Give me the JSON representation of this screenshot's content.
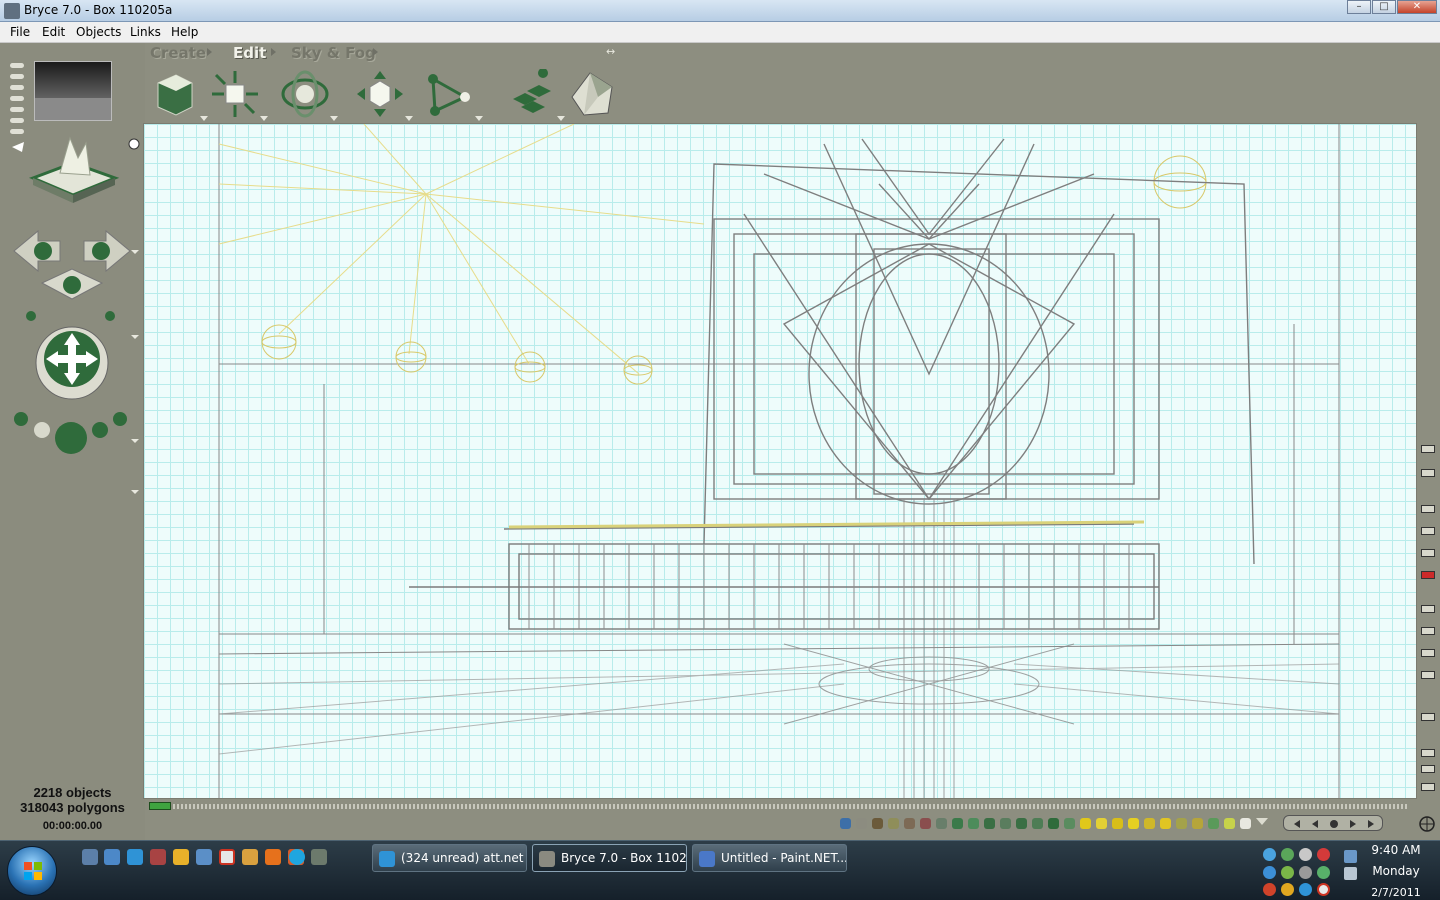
{
  "window": {
    "title": "Bryce 7.0 - Box 110205a",
    "minimize": "–",
    "maximize": "□",
    "close": "✕"
  },
  "menu": [
    "File",
    "Edit",
    "Objects",
    "Links",
    "Help"
  ],
  "palette_tabs": [
    "Create",
    "Edit",
    "Sky & Fog"
  ],
  "status": {
    "objects": "2218 objects",
    "polygons": "318043 polygons",
    "time": "00:00:00.00"
  },
  "taskbar": {
    "buttons": [
      {
        "label": "(324 unread) att.net ..."
      },
      {
        "label": "Bryce 7.0 - Box 1102..."
      },
      {
        "label": "Untitled - Paint.NET..."
      }
    ]
  },
  "clock": {
    "time": "9:40 AM",
    "day": "Monday",
    "date": "2/7/2011"
  },
  "icons": {
    "start": "windows-logo-icon",
    "quick_launch": [
      "desktop-icon",
      "explorer-icon",
      "internet-explorer-icon",
      "media-icon",
      "folder-icon",
      "window-icon",
      "gmail-icon",
      "book-icon",
      "firefox-icon",
      "paint-icon",
      "skype-icon",
      "bryce-icon"
    ]
  },
  "colors": {
    "accent_green": "#2f6b3b",
    "canvas_bg": "#eefcfb",
    "grid": "#b9eceb",
    "panel": "#8d8e80"
  }
}
